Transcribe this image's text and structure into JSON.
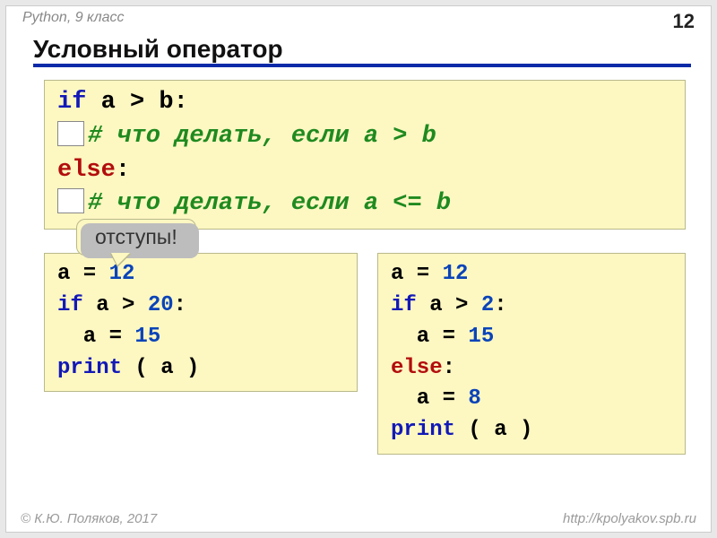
{
  "header": {
    "course": "Python, 9 класс",
    "page": "12"
  },
  "title": "Условный оператор",
  "main_code": {
    "l1_if": "if",
    "l1_cond": " a > b:",
    "l2_cmt": "# что делать, если a > b",
    "l3_else": "else",
    "l3_colon": ":",
    "l4_cmt": "# что делать, если a <= b"
  },
  "callout": "отступы!",
  "left_code": {
    "l1_a": "a = ",
    "l1_n": "12",
    "l2_if": "if",
    "l2_mid": " a > ",
    "l2_n": "20",
    "l2_colon": ":",
    "l3_a": "  a = ",
    "l3_n": "15",
    "l4_print": "print",
    "l4_rest": " ( a )"
  },
  "right_code": {
    "l1_a": "a = ",
    "l1_n": "12",
    "l2_if": "if",
    "l2_mid": " a > ",
    "l2_n": "2",
    "l2_colon": ":",
    "l3_a": "  a = ",
    "l3_n": "15",
    "l4_else": "else",
    "l4_colon": ":",
    "l5_a": "  a = ",
    "l5_n": "8",
    "l6_print": "print",
    "l6_rest": " ( a )"
  },
  "footer": {
    "left": "© К.Ю. Поляков, 2017",
    "right": "http://kpolyakov.spb.ru"
  }
}
